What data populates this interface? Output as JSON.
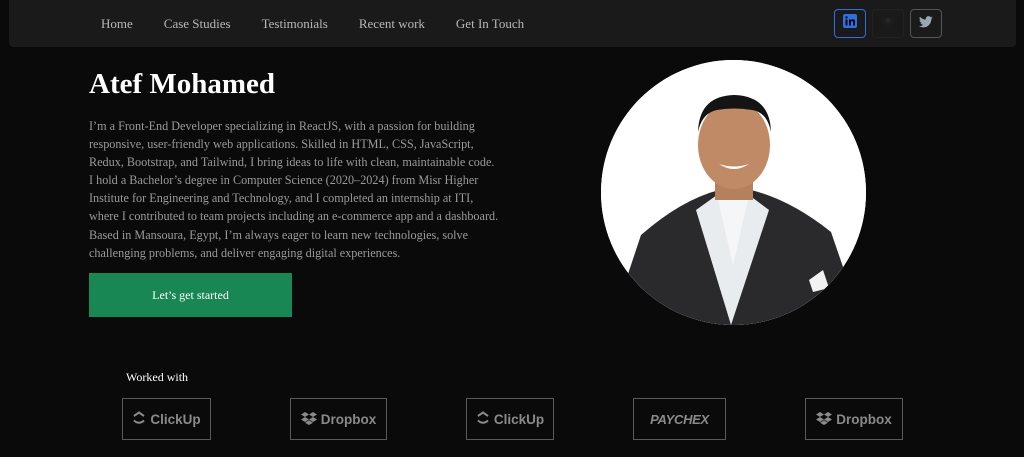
{
  "nav": {
    "links": [
      "Home",
      "Case Studies",
      "Testimonials",
      "Recent work",
      "Get In Touch"
    ],
    "social": [
      "linkedin-icon",
      "github-icon",
      "twitter-icon"
    ]
  },
  "hero": {
    "name": "Atef Mohamed",
    "bio": "I’m a Front-End Developer specializing in ReactJS, with a passion for building responsive, user-friendly web applications. Skilled in HTML, CSS, JavaScript, Redux, Bootstrap, and Tailwind, I bring ideas to life with clean, maintainable code. I hold a Bachelor’s degree in Computer Science (2020–2024) from Misr Higher Institute for Engineering and Technology, and I completed an internship at ITI, where I contributed to team projects including an e-commerce app and a dashboard. Based in Mansoura, Egypt, I’m always eager to learn new technologies, solve challenging problems, and deliver engaging digital experiences.",
    "cta_label": "Let’s get started"
  },
  "worked_with": {
    "label": "Worked with",
    "logos": [
      "ClickUp",
      "Dropbox",
      "ClickUp",
      "PAYCHEX",
      "Dropbox"
    ]
  },
  "colors": {
    "background": "#0a0a0a",
    "navbar": "#1a1a1a",
    "accent_green": "#198754",
    "linkedin_blue": "#2f6fe0"
  }
}
